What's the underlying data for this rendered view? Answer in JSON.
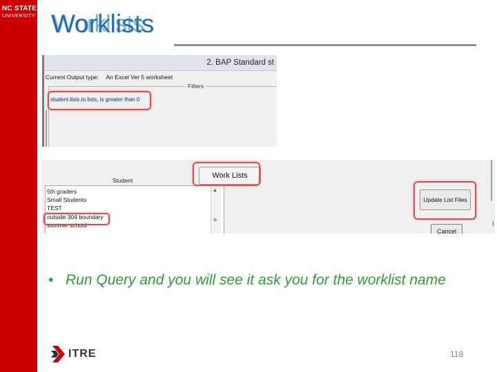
{
  "brand": {
    "logo_line1": "NC STATE",
    "logo_line2": "UNIVERSITY",
    "sidebar_color": "#cc0000"
  },
  "slide": {
    "title": "Worklists",
    "title_color": "#1f6fb2",
    "bullet": "Run Query and you will see it ask you for the worklist name",
    "bullet_color": "#2e9f38",
    "page_number": "118"
  },
  "screenshot1": {
    "window_title": "2. BAP Standard st",
    "output_type_label": "Current Output type:",
    "output_type_value": "An Excel Ver 5 worksheet",
    "filters_legend": "Filters",
    "filter_condition": "student.lists.to.lists, is greater than 0",
    "highlight_color": "#e14b4b"
  },
  "screenshot2": {
    "column_header": "Student",
    "work_lists_button": "Work Lists",
    "update_list_files_button": "Update List Files",
    "cancel_button": "Cancel",
    "list_items": [
      "5th graders",
      "Small Students",
      "TEST",
      "outside 304 boundary",
      "summer school"
    ],
    "scroll_up": "▲",
    "scroll_grip": "≡",
    "edge_char": "I"
  },
  "footer": {
    "logo_text": "ITRE"
  }
}
